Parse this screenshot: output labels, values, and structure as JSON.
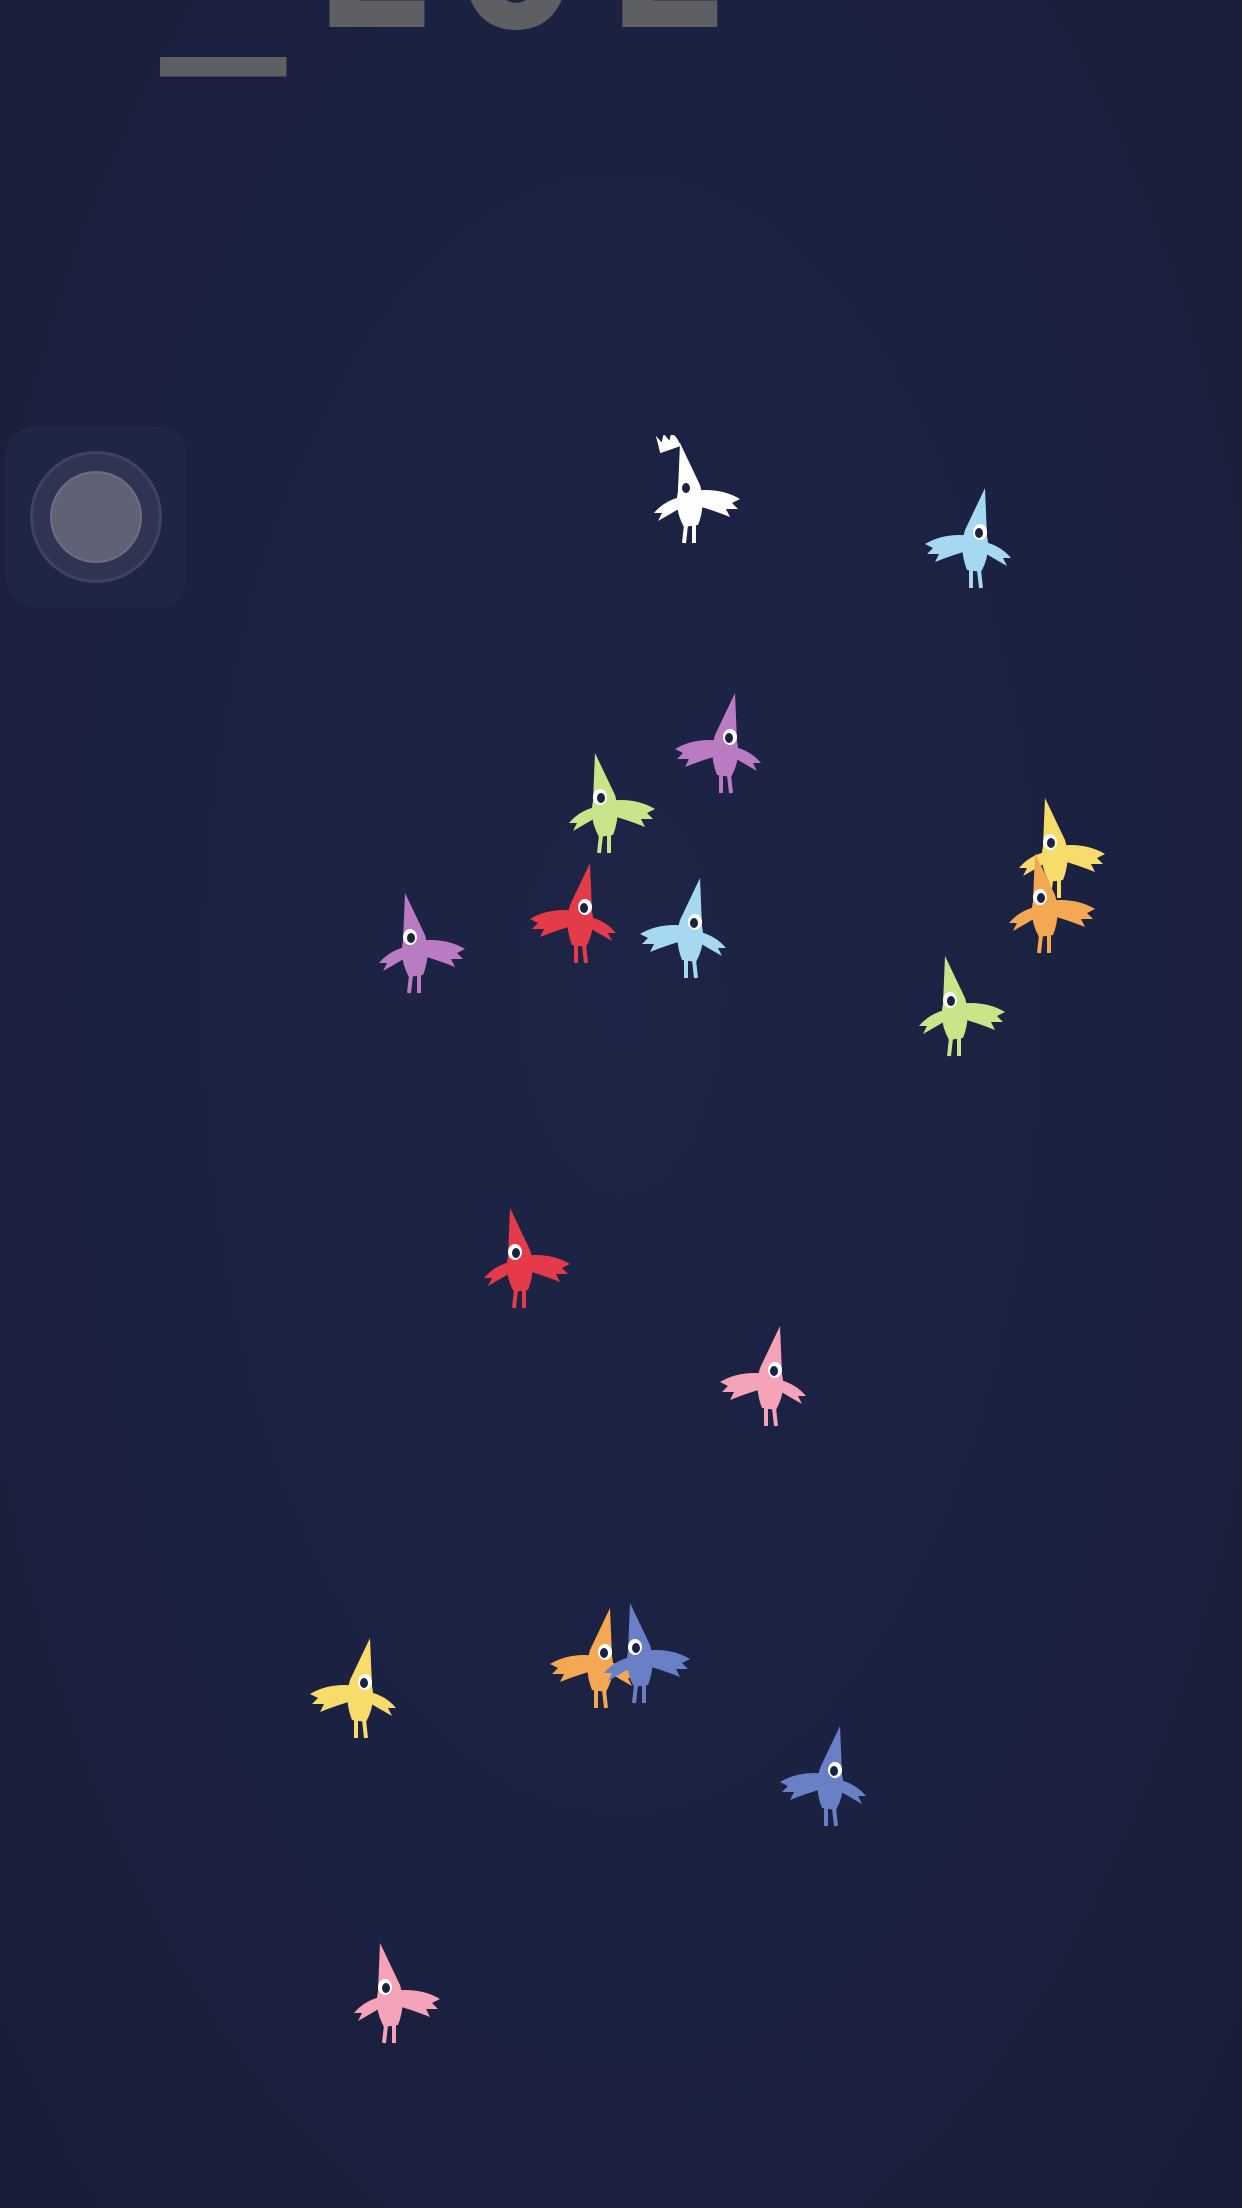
{
  "hud": {
    "score_text": "_LOL",
    "joystick_icon": "joystick-icon"
  },
  "colors": {
    "background": "#1b2140",
    "diamond_face": "#d3d4ae",
    "diamond_edge": "#4f7b7f",
    "joystick_knob": "#5f6277"
  },
  "birds": [
    {
      "id": "white-crown",
      "color": "#ffffff",
      "crown": true,
      "dir": 1
    },
    {
      "id": "light-blue-1",
      "color": "#a6d8f2",
      "crown": false,
      "dir": -1
    },
    {
      "id": "purple-1",
      "color": "#b97bc2",
      "crown": false,
      "dir": -1
    },
    {
      "id": "lime-1",
      "color": "#c9e58a",
      "crown": false,
      "dir": 1
    },
    {
      "id": "red-1",
      "color": "#e43a4a",
      "crown": false,
      "dir": -1
    },
    {
      "id": "light-blue-2",
      "color": "#a6d8f2",
      "crown": false,
      "dir": -1
    },
    {
      "id": "purple-2",
      "color": "#b97bc2",
      "crown": false,
      "dir": 1
    },
    {
      "id": "yellow-1",
      "color": "#f7dc6c",
      "crown": false,
      "dir": 1
    },
    {
      "id": "orange-1",
      "color": "#f5a852",
      "crown": false,
      "dir": 1
    },
    {
      "id": "lime-2",
      "color": "#c9e58a",
      "crown": false,
      "dir": 1
    },
    {
      "id": "red-2",
      "color": "#e43a4a",
      "crown": false,
      "dir": 1
    },
    {
      "id": "pink-1",
      "color": "#f5a3b8",
      "crown": false,
      "dir": -1
    },
    {
      "id": "yellow-2",
      "color": "#f7dc6c",
      "crown": false,
      "dir": -1
    },
    {
      "id": "orange-2",
      "color": "#f5a852",
      "crown": false,
      "dir": -1
    },
    {
      "id": "blue-1",
      "color": "#6a80c6",
      "crown": false,
      "dir": 1
    },
    {
      "id": "blue-2",
      "color": "#6a80c6",
      "crown": false,
      "dir": -1
    },
    {
      "id": "pink-2",
      "color": "#f5a3b8",
      "crown": false,
      "dir": 1
    }
  ]
}
